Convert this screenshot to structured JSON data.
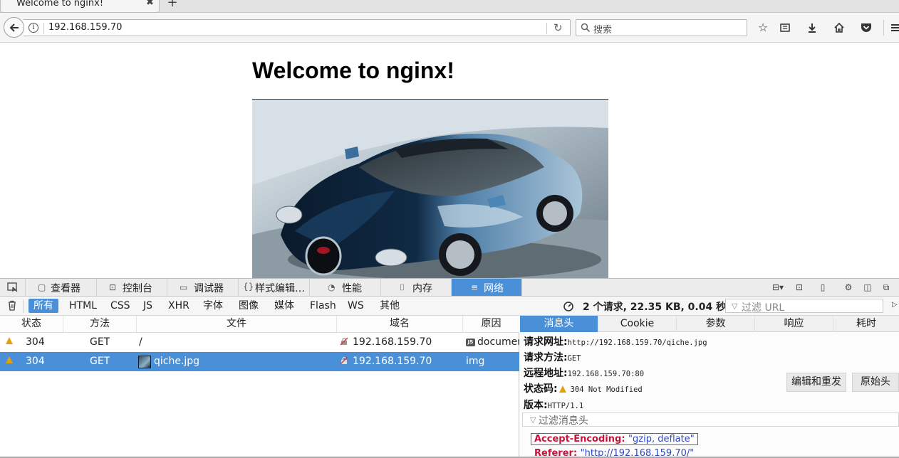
{
  "browser": {
    "tab_title": "Welcome to nginx!",
    "tab_close": "✖",
    "new_tab": "+",
    "url": "192.168.159.70",
    "reload": "↻",
    "search_placeholder": "搜索"
  },
  "page": {
    "heading": "Welcome to nginx!",
    "image_subject": "blue sports car photo (qiche.jpg)"
  },
  "devtools": {
    "tabs": [
      {
        "label": "查看器",
        "icon": "inspector-icon"
      },
      {
        "label": "控制台",
        "icon": "console-icon"
      },
      {
        "label": "调试器",
        "icon": "debugger-icon"
      },
      {
        "label": "样式编辑…",
        "icon": "style-editor-icon"
      },
      {
        "label": "性能",
        "icon": "performance-icon"
      },
      {
        "label": "内存",
        "icon": "memory-icon"
      },
      {
        "label": "网络",
        "icon": "network-icon"
      }
    ],
    "active_tab": "网络",
    "filters": [
      "所有",
      "HTML",
      "CSS",
      "JS",
      "XHR",
      "字体",
      "图像",
      "媒体",
      "Flash",
      "WS",
      "其他"
    ],
    "active_filter": "所有",
    "summary": "2 个请求, 22.35 KB, 0.04 秒",
    "url_filter_placeholder": "过滤 URL",
    "columns": [
      "状态",
      "方法",
      "文件",
      "域名",
      "原因"
    ],
    "requests": [
      {
        "status": "304",
        "method": "GET",
        "file": "/",
        "domain": "192.168.159.70",
        "cause": "document"
      },
      {
        "status": "304",
        "method": "GET",
        "file": "qiche.jpg",
        "domain": "192.168.159.70",
        "cause": "img"
      }
    ],
    "selected_row": 1,
    "details": {
      "tabs": [
        "消息头",
        "Cookie",
        "参数",
        "响应",
        "耗时"
      ],
      "active_tab": "消息头",
      "request_url_label": "请求网址:",
      "request_url": "http://192.168.159.70/qiche.jpg",
      "method_label": "请求方法:",
      "method": "GET",
      "remote_label": "远程地址:",
      "remote": "192.168.159.70:80",
      "status_label": "状态码:",
      "status": "304  Not Modified",
      "version_label": "版本:",
      "version": "HTTP/1.1",
      "edit_resend": "编辑和重发",
      "raw_headers": "原始头",
      "header_filter_placeholder": "过滤消息头",
      "headers": [
        {
          "key": "Accept-Encoding",
          "value": "\"gzip, deflate\""
        },
        {
          "key": "Referer",
          "value": "\"http://192.168.159.70/\""
        }
      ]
    }
  },
  "colors": {
    "accent": "#4a90d9",
    "warning": "#e5a00d",
    "header_key": "#c8133a",
    "header_value": "#2f4ac4"
  }
}
